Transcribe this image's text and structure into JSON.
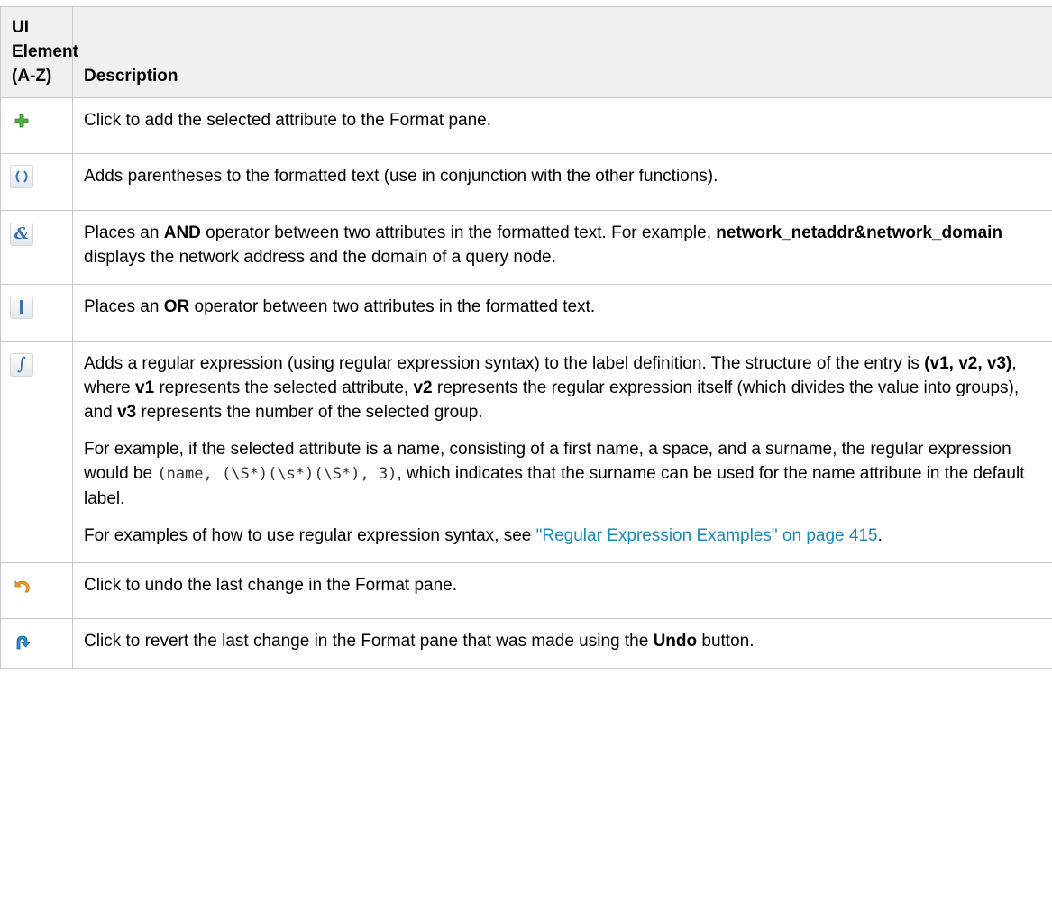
{
  "header": {
    "col1": "UI Element (A-Z)",
    "col1_lines": [
      "UI",
      "Element",
      "(A-Z)"
    ],
    "col2": "Description"
  },
  "rows": {
    "add": {
      "icon": "plus-icon",
      "desc": "Click to add the selected attribute to the Format pane."
    },
    "parens": {
      "icon": "parentheses-icon",
      "desc": "Adds parentheses to the formatted text (use in conjunction with the other functions)."
    },
    "and": {
      "icon": "ampersand-icon",
      "d1": "Places an ",
      "d1_bold": "AND",
      "d2": " operator between two attributes in the formatted text. For example, ",
      "d2_bold": "network_netaddr&network_domain",
      "d3": " displays the network address and the domain of a query node."
    },
    "or": {
      "icon": "pipe-icon",
      "d1": "Places an ",
      "d1_bold": "OR",
      "d2": " operator between two attributes in the formatted text."
    },
    "regex": {
      "icon": "function-icon",
      "p1a": "Adds a regular expression (using regular expression syntax) to the label definition. The structure of the entry is ",
      "p1b": "(v1, v2, v3)",
      "p1c": ", where ",
      "p1d": "v1",
      "p1e": " represents the selected attribute, ",
      "p1f": "v2",
      "p1g": " represents the regular expression itself (which divides the value into groups), and ",
      "p1h": "v3",
      "p1i": " represents the number of the selected group.",
      "p2a": "For example, if the selected attribute is a name, consisting of a first name, a space, and a surname, the regular expression would be ",
      "p2code": "(name, (\\S*)(\\s*)(\\S*), 3)",
      "p2b": ", which indicates that the surname can be used for the name attribute in the default label.",
      "p3a": "For examples of how to use regular expression syntax, see ",
      "p3link": "\"Regular Expression Examples\" on page 415",
      "p3b": "."
    },
    "undo": {
      "icon": "undo-icon",
      "desc": "Click to undo the last change in the Format pane."
    },
    "redo": {
      "icon": "redo-icon",
      "d1": "Click to revert the last change in the Format pane that was made using the ",
      "d1_bold": "Undo",
      "d2": " button."
    }
  },
  "colors": {
    "header_bg": "#f0f0f0",
    "border": "#c8c8c8",
    "link": "#1a8bb8",
    "plus_green": "#3fa53a",
    "icon_blue": "#3a6fb0",
    "undo_orange": "#e59b28"
  }
}
